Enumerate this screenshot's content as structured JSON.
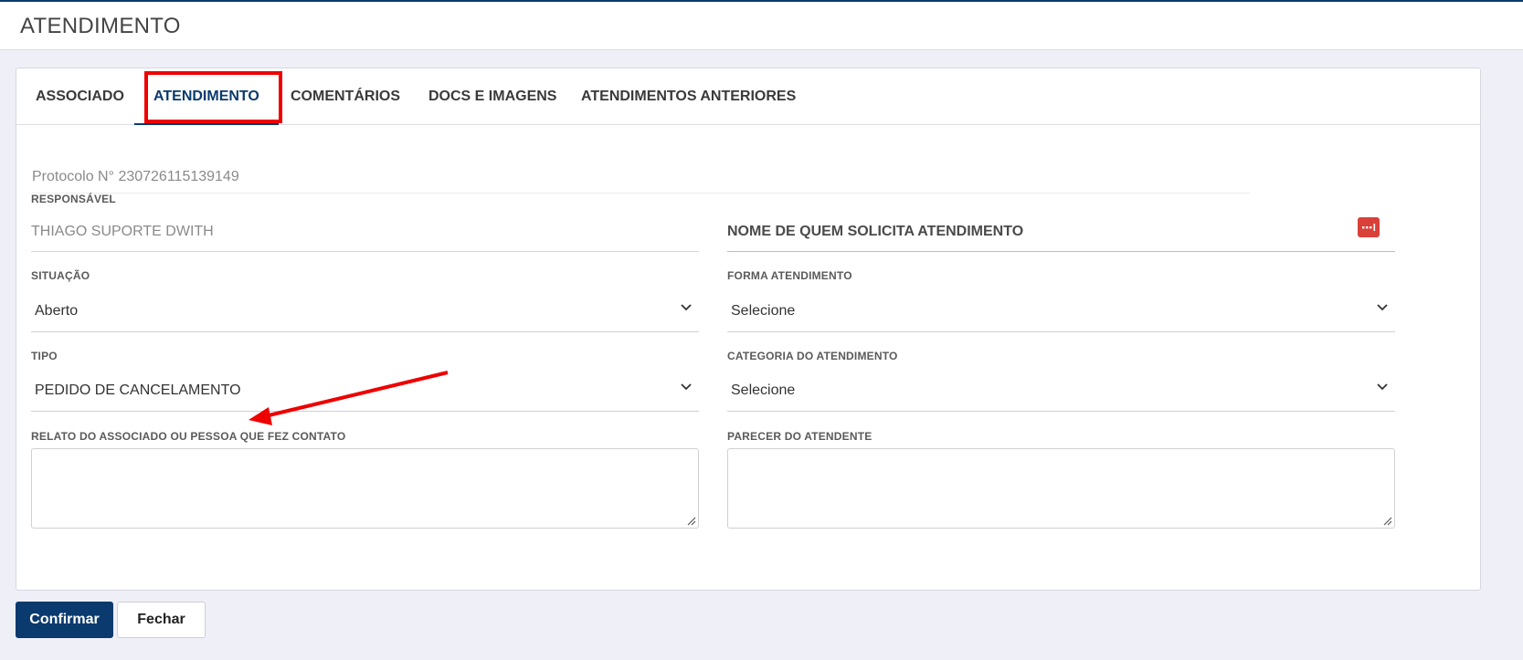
{
  "header": {
    "title": "ATENDIMENTO"
  },
  "tabs": [
    {
      "label": "ASSOCIADO",
      "active": false
    },
    {
      "label": "ATENDIMENTO",
      "active": true
    },
    {
      "label": "COMENTÁRIOS",
      "active": false
    },
    {
      "label": "DOCS E IMAGENS",
      "active": false
    },
    {
      "label": "ATENDIMENTOS ANTERIORES",
      "active": false
    }
  ],
  "form": {
    "protocol": "Protocolo N° 230726115139149",
    "responsavel": {
      "label": "RESPONSÁVEL",
      "value": "THIAGO SUPORTE DWITH"
    },
    "solicitante": {
      "label": "NOME DE QUEM SOLICITA ATENDIMENTO",
      "icon": "more-dots-icon"
    },
    "situacao": {
      "label": "SITUAÇÃO",
      "value": "Aberto"
    },
    "forma_atendimento": {
      "label": "FORMA ATENDIMENTO",
      "value": "Selecione"
    },
    "tipo": {
      "label": "TIPO",
      "value": "PEDIDO DE CANCELAMENTO"
    },
    "categoria": {
      "label": "CATEGORIA DO ATENDIMENTO",
      "value": "Selecione"
    },
    "relato": {
      "label": "RELATO DO ASSOCIADO OU PESSOA QUE FEZ CONTATO",
      "value": ""
    },
    "parecer": {
      "label": "PARECER DO ATENDENTE",
      "value": ""
    }
  },
  "buttons": {
    "confirm": "Confirmar",
    "close": "Fechar"
  },
  "annotations": {
    "highlight_color": "#ee0000",
    "arrow_color": "#ee0000"
  },
  "colors": {
    "primary": "#0a3a6e",
    "danger": "#d9403a",
    "background": "#eeeff7"
  }
}
